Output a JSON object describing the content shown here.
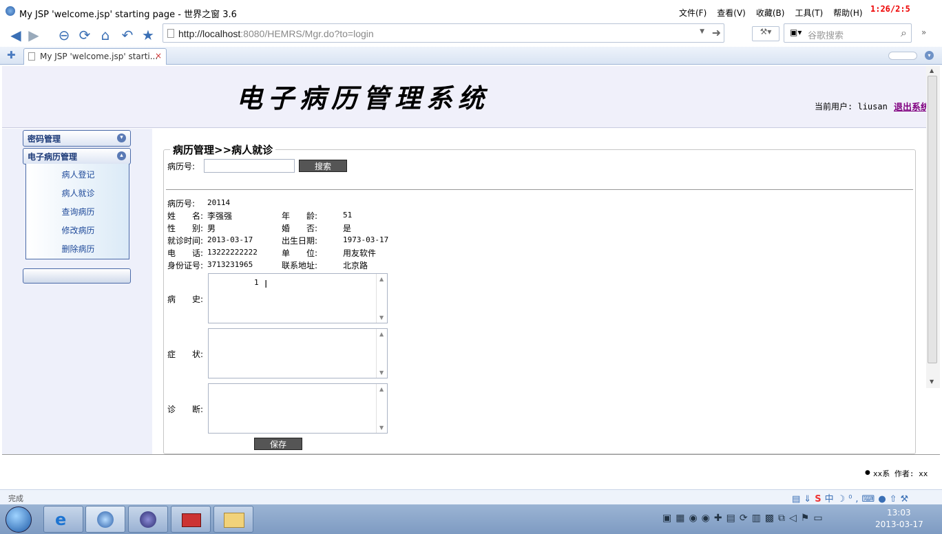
{
  "window": {
    "title": "My JSP 'welcome.jsp' starting page - 世界之窗 3.6",
    "timer_overlay": "1:26/2:5"
  },
  "menu": [
    "文件(F)",
    "查看(V)",
    "收藏(B)",
    "工具(T)",
    "帮助(H)"
  ],
  "address": {
    "host": "http://localhost",
    "rest": ":8080/HEMRS/Mgr.do?to=login"
  },
  "search": {
    "placeholder": "谷歌搜索"
  },
  "tab": {
    "label": "My JSP 'welcome.jsp' starti..."
  },
  "header": {
    "system_title": "电子病历管理系统",
    "current_user_label": "当前用户:",
    "current_user": "liusan",
    "logout": "退出系统"
  },
  "sidebar": {
    "sections": [
      {
        "label": "密码管理"
      },
      {
        "label": "电子病历管理"
      }
    ],
    "items": [
      "病人登记",
      "病人就诊",
      "查询病历",
      "修改病历",
      "删除病历"
    ]
  },
  "main": {
    "legend": "病历管理>>病人就诊",
    "search_label": "病历号:",
    "search_value": "",
    "search_button": "搜索",
    "fields": {
      "record_no_label": "病历号:",
      "record_no": "20114",
      "name_label": "姓　　名:",
      "name": "李强强",
      "age_label": "年　　龄:",
      "age": "51",
      "gender_label": "性　　别:",
      "gender": "男",
      "married_label": "婚　　否:",
      "married": "是",
      "visit_time_label": "就诊时间:",
      "visit_time": "2013-03-17",
      "birth_label": "出生日期:",
      "birth": "1973-03-17",
      "phone_label": "电　　话:",
      "phone": "13222222222",
      "org_label": "单　　位:",
      "org": "用友软件",
      "id_label": "身份证号:",
      "id": "3713231965",
      "addr_label": "联系地址:",
      "addr": "北京路"
    },
    "history_label": "病　　史:",
    "history_value": "1",
    "symptom_label": "症　　状:",
    "symptom_value": "",
    "diagnosis_label": "诊　　断:",
    "diagnosis_value": "",
    "save_button": "保存"
  },
  "footer": {
    "credit": "xx系 作者: xx"
  },
  "status": {
    "text": "完成"
  },
  "clock": {
    "time": "13:03",
    "date": "2013-03-17"
  }
}
